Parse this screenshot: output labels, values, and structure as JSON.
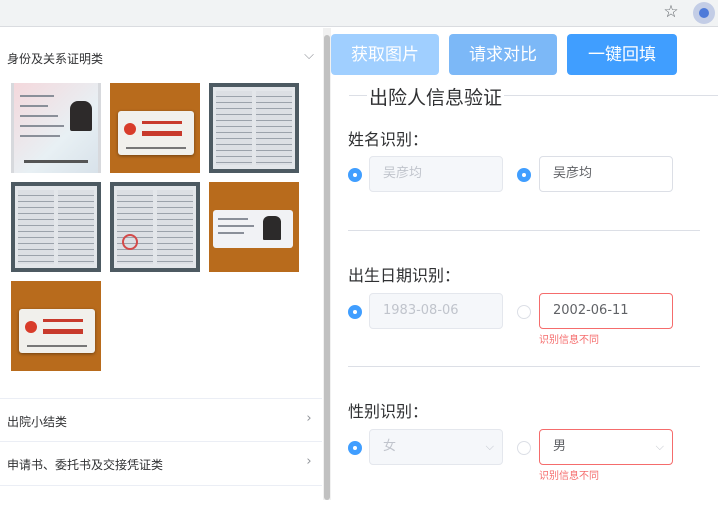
{
  "browser": {
    "bookmark_icon": "star-icon",
    "extension_icon": "extension-icon"
  },
  "left": {
    "categories": [
      {
        "label": "身份及关系证明类",
        "icon": "chevron-down-icon",
        "expanded": true
      },
      {
        "label": "出院小结类",
        "icon": "chevron-right-icon",
        "expanded": false
      },
      {
        "label": "申请书、委托书及交接凭证类",
        "icon": "chevron-right-icon",
        "expanded": false
      }
    ]
  },
  "toolbar": {
    "get_image_label": "获取图片",
    "request_compare_label": "请求对比",
    "one_click_fill_label": "一键回填"
  },
  "form": {
    "title": "出险人信息验证",
    "error_text": "识别信息不同",
    "name": {
      "label": "姓名识别：",
      "left_value": "吴彦均",
      "right_value": "吴彦均"
    },
    "birth": {
      "label": "出生日期识别：",
      "left_value": "1983-08-06",
      "right_value": "2002-06-11"
    },
    "gender": {
      "label": "性别识别：",
      "left_value": "女",
      "right_value": "男"
    }
  },
  "colors": {
    "primary": "#409eff",
    "error": "#f56c6c",
    "thumb_background": "#b86b1c"
  }
}
